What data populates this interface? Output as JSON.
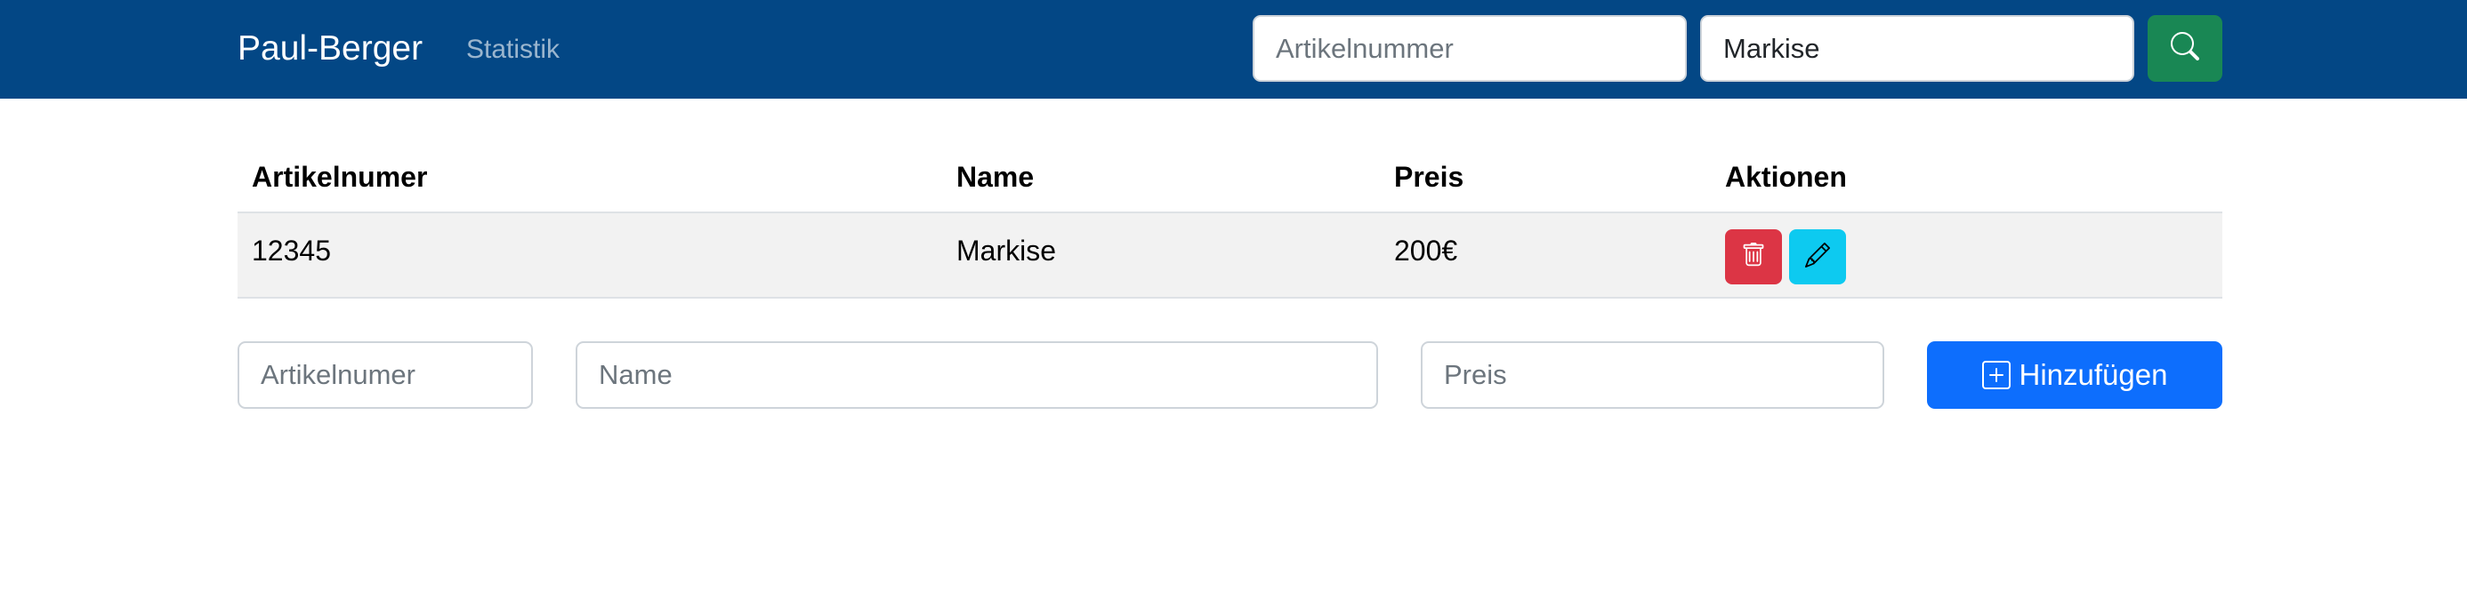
{
  "navbar": {
    "brand": "Paul-Berger",
    "links": [
      "Statistik"
    ],
    "search": {
      "article_placeholder": "Artikelnummer",
      "article_value": "",
      "name_placeholder": "",
      "name_value": "Markise",
      "button_icon": "search-icon",
      "button_color": "#198754"
    },
    "background": "#034785"
  },
  "table": {
    "headers": [
      "Artikelnumer",
      "Name",
      "Preis",
      "Aktionen"
    ],
    "rows": [
      {
        "artikelnummer": "12345",
        "name": "Markise",
        "preis": "200€",
        "actions": [
          "trash-icon",
          "pencil-icon"
        ]
      }
    ]
  },
  "form": {
    "artikel_placeholder": "Artikelnumer",
    "name_placeholder": "Name",
    "preis_placeholder": "Preis",
    "add_label": "Hinzufügen",
    "add_icon": "plus-square-icon",
    "add_color": "#0d6efd"
  },
  "colors": {
    "delete": "#dc3545",
    "edit": "#0dcaf0"
  }
}
